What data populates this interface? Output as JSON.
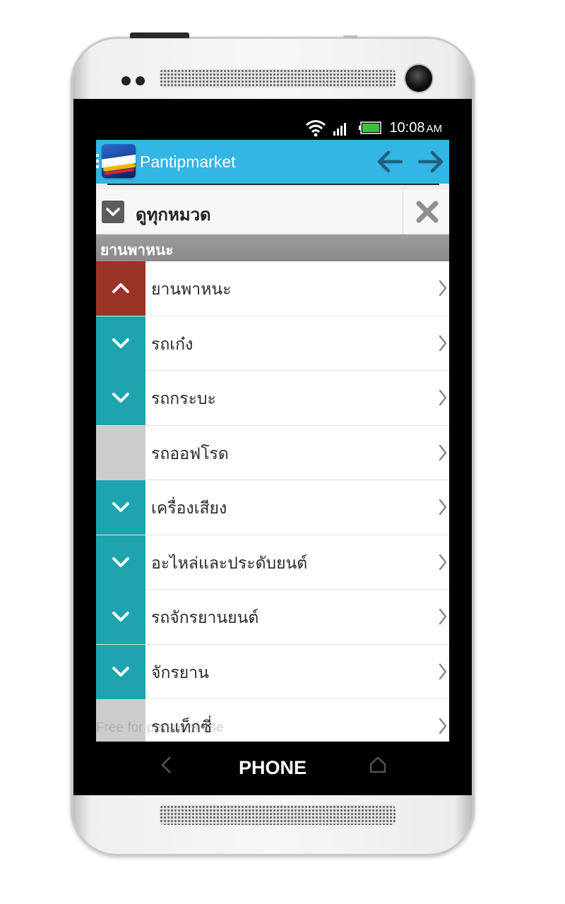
{
  "device": {
    "brand_label": "PHONE"
  },
  "statusbar": {
    "time": "10:08",
    "ampm": "AM"
  },
  "actionbar": {
    "app_title": "Pantipmarket"
  },
  "filter": {
    "all_categories_label": "ดูทุกหมวด"
  },
  "section": {
    "title": "ยานพาหนะ"
  },
  "watermark": "Free for personal use",
  "colors": {
    "actionbar": "#33b5e5",
    "expanded": "#9a3226",
    "collapsible": "#1ea4ae",
    "empty": "#cccccc"
  },
  "list": {
    "items": [
      {
        "label": "ยานพาหนะ",
        "state": "expanded",
        "toggle_icon": "chevron-up-icon"
      },
      {
        "label": "รถเก๋ง",
        "state": "collapsible",
        "toggle_icon": "chevron-down-icon"
      },
      {
        "label": "รถกระบะ",
        "state": "collapsible",
        "toggle_icon": "chevron-down-icon"
      },
      {
        "label": "รถออฟโรด",
        "state": "empty",
        "toggle_icon": ""
      },
      {
        "label": "เครื่องเสียง",
        "state": "collapsible",
        "toggle_icon": "chevron-down-icon"
      },
      {
        "label": "อะไหล่และประดับยนต์",
        "state": "collapsible",
        "toggle_icon": "chevron-down-icon"
      },
      {
        "label": "รถจักรยานยนต์",
        "state": "collapsible",
        "toggle_icon": "chevron-down-icon"
      },
      {
        "label": "จักรยาน",
        "state": "collapsible",
        "toggle_icon": "chevron-down-icon"
      },
      {
        "label": "รถแท็กซี่",
        "state": "empty",
        "toggle_icon": ""
      }
    ]
  }
}
